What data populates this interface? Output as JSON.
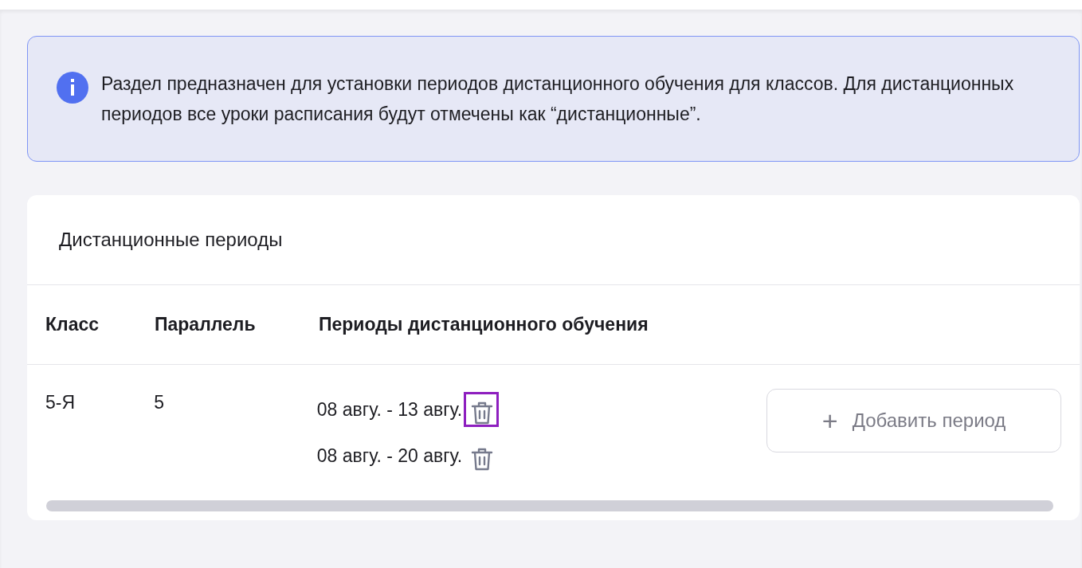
{
  "notice": {
    "text": "Раздел предназначен для установки периодов дистанционного обучения для классов. Для дистанционных периодов все уроки расписания будут отмечены как “дистанционные”."
  },
  "card": {
    "title": "Дистанционные периоды",
    "columns": [
      "Класс",
      "Параллель",
      "Периоды дистанционного обучения"
    ],
    "rows": [
      {
        "class": "5-Я",
        "parallel": "5",
        "periods": [
          {
            "text": "08 авгу. - 13 авгу.",
            "focused": true
          },
          {
            "text": "08 авгу. - 20 авгу.",
            "focused": false
          }
        ],
        "add_button": {
          "icon": "+",
          "label": "Добавить период"
        }
      }
    ]
  }
}
